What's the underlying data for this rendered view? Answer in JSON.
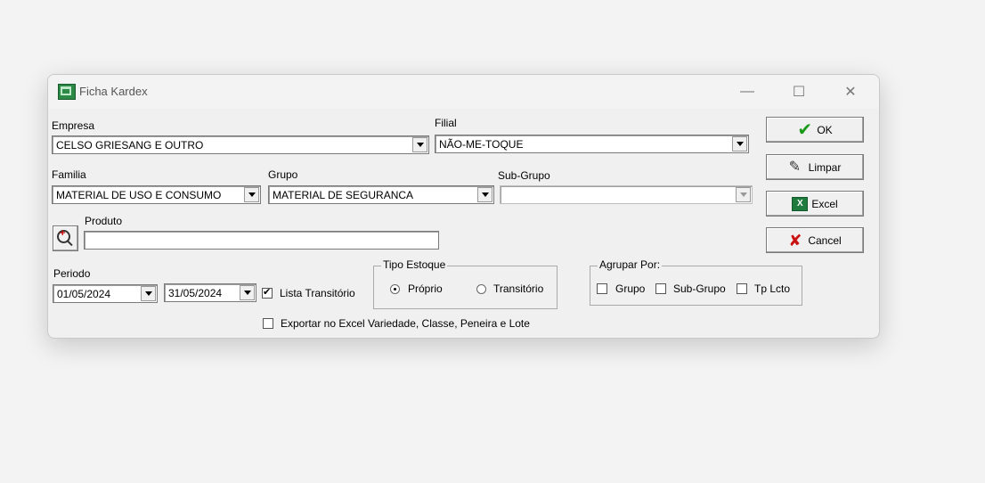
{
  "window": {
    "title": "Ficha Kardex",
    "minimize": "—",
    "maximize": "☐",
    "close": "✕"
  },
  "empresa": {
    "label": "Empresa",
    "value": "CELSO GRIESANG E OUTRO"
  },
  "filial": {
    "label": "Filial",
    "value": "NÃO-ME-TOQUE"
  },
  "familia": {
    "label": "Familia",
    "value": "MATERIAL DE USO E CONSUMO"
  },
  "grupo": {
    "label": "Grupo",
    "value": "MATERIAL DE SEGURANCA"
  },
  "subgrupo": {
    "label": "Sub-Grupo",
    "value": ""
  },
  "produto": {
    "label": "Produto",
    "value": ""
  },
  "periodo": {
    "label": "Periodo",
    "start": "01/05/2024",
    "end": "31/05/2024"
  },
  "lista_transitorio": {
    "label": "Lista Transitório",
    "checked": true
  },
  "tipo_estoque": {
    "title": "Tipo Estoque",
    "options": [
      "Próprio",
      "Transitório"
    ],
    "selected": "Próprio"
  },
  "agrupar_por": {
    "title": "Agrupar Por:",
    "options": [
      "Grupo",
      "Sub-Grupo",
      "Tp Lcto"
    ]
  },
  "exportar": {
    "label": "Exportar no Excel Variedade, Classe, Peneira e Lote",
    "checked": false
  },
  "buttons": {
    "ok": "OK",
    "limpar": "Limpar",
    "excel": "Excel",
    "cancel": "Cancel"
  },
  "icons": {
    "ok": "check-icon",
    "limpar": "eraser-icon",
    "excel": "excel-icon",
    "cancel": "x-icon",
    "search": "zoom-in-icon",
    "app": "kardex-app-icon"
  },
  "colors": {
    "ok_check": "#1a9a1a",
    "cancel_x": "#cc1111",
    "excel_green": "#1f7a3d"
  }
}
